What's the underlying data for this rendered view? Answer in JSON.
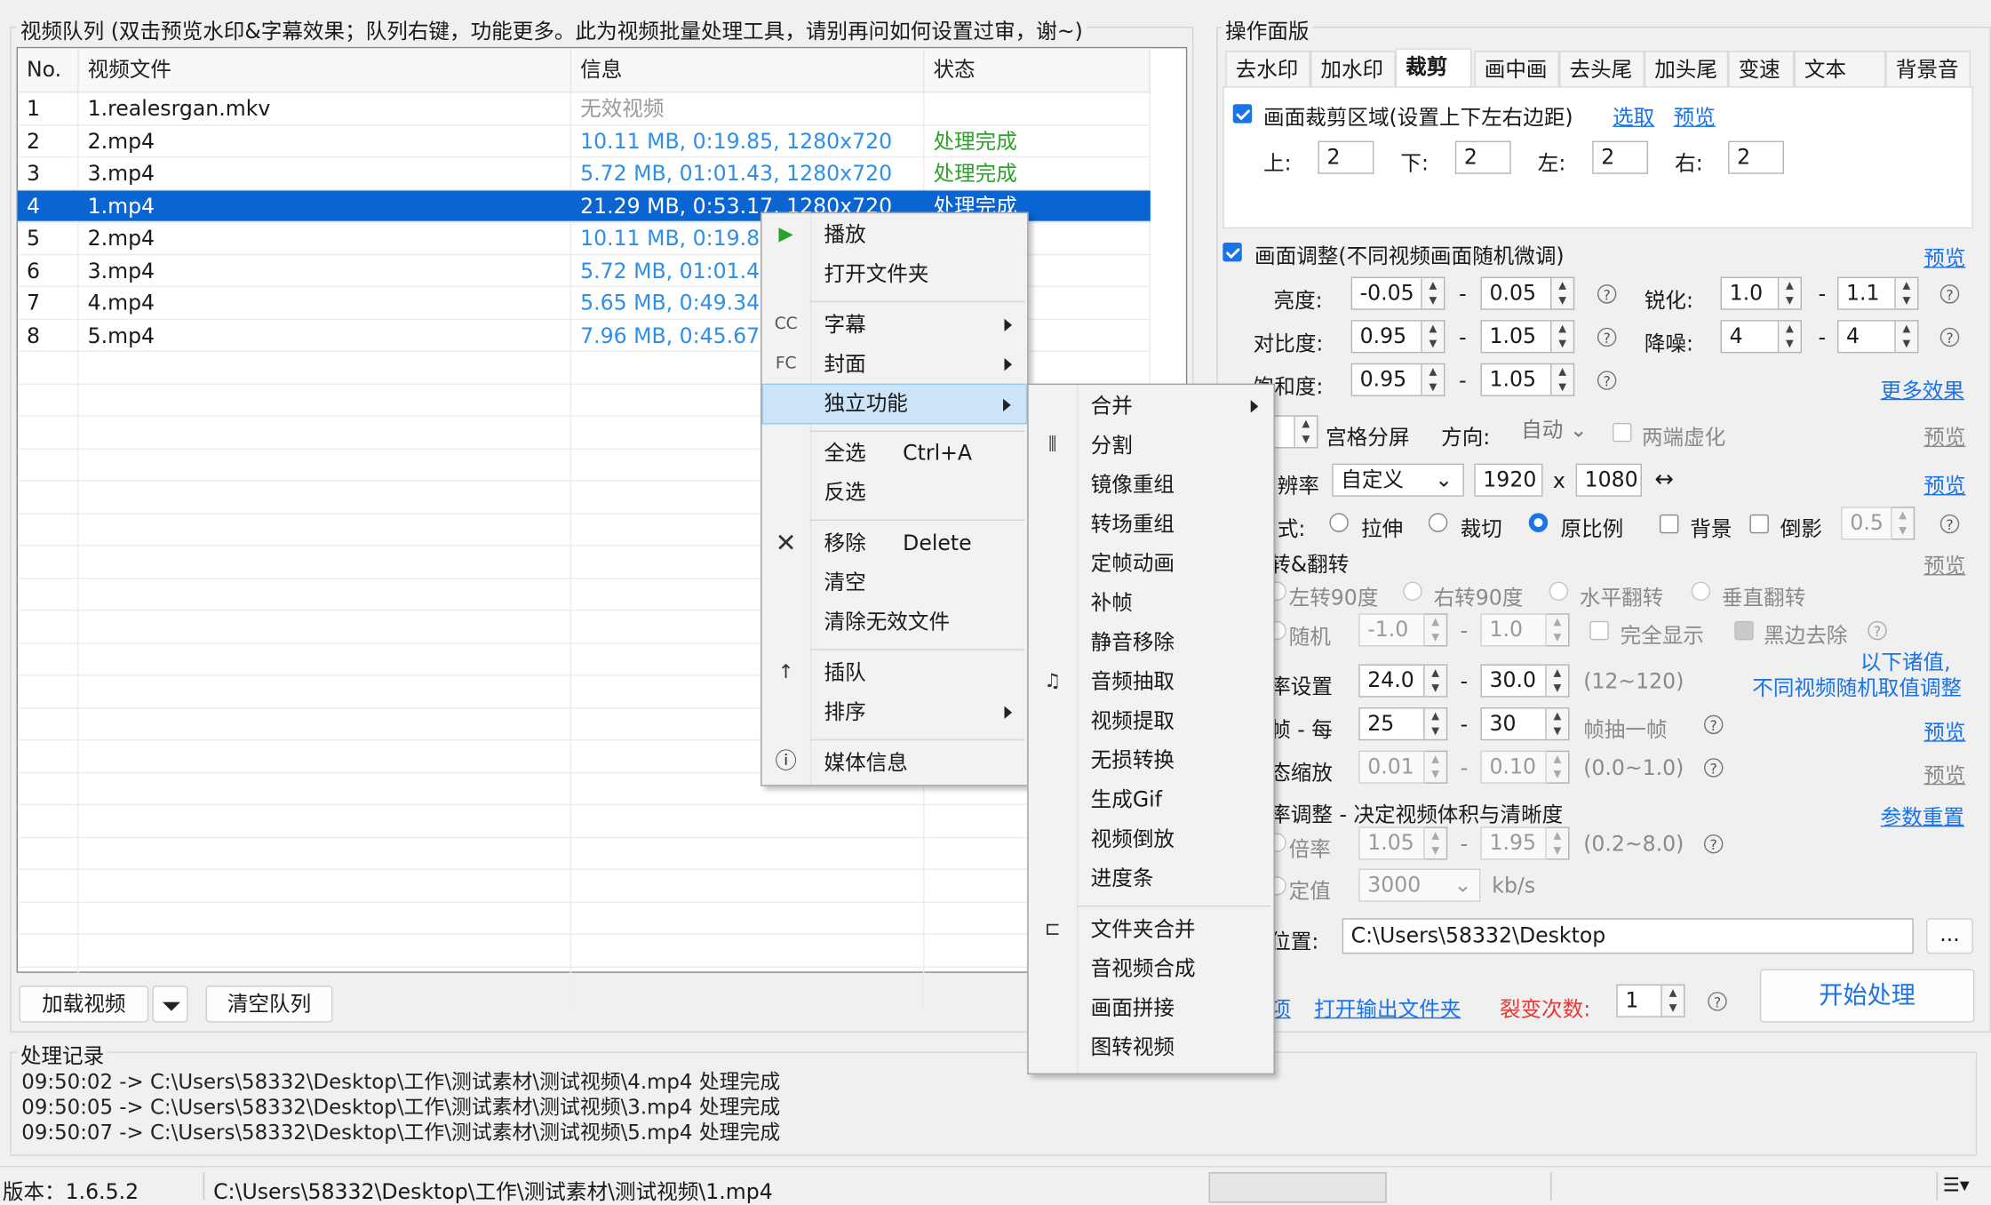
{
  "queue": {
    "title": "视频队列 (双击预览水印&字幕效果；队列右键，功能更多。此为视频批量处理工具，请别再问如何设置过审，谢~)",
    "columns": [
      "No.",
      "视频文件",
      "信息",
      "状态"
    ],
    "rows": [
      {
        "no": "1",
        "file": "1.realesrgan.mkv",
        "info": "无效视频",
        "status": ""
      },
      {
        "no": "2",
        "file": "2.mp4",
        "info": "10.11 MB, 0:19.85, 1280x720",
        "status": "处理完成"
      },
      {
        "no": "3",
        "file": "3.mp4",
        "info": "5.72 MB, 01:01.43, 1280x720",
        "status": "处理完成"
      },
      {
        "no": "4",
        "file": "1.mp4",
        "info": "21.29 MB, 0:53.17, 1280x720",
        "status": "处理完成"
      },
      {
        "no": "5",
        "file": "2.mp4",
        "info": "10.11 MB, 0:19.85",
        "status": ""
      },
      {
        "no": "6",
        "file": "3.mp4",
        "info": "5.72 MB, 01:01.43",
        "status": ""
      },
      {
        "no": "7",
        "file": "4.mp4",
        "info": "5.65 MB, 0:49.34,",
        "status": ""
      },
      {
        "no": "8",
        "file": "5.mp4",
        "info": "7.96 MB, 0:45.67,",
        "status": ""
      }
    ],
    "selected_row": 4,
    "load_button": "加载视频",
    "clear_button": "清空队列"
  },
  "log": {
    "title": "处理记录",
    "lines": [
      "09:50:02 -> C:\\Users\\58332\\Desktop\\工作\\测试素材\\测试视频\\4.mp4 处理完成",
      "09:50:05 -> C:\\Users\\58332\\Desktop\\工作\\测试素材\\测试视频\\3.mp4 处理完成",
      "09:50:07 -> C:\\Users\\58332\\Desktop\\工作\\测试素材\\测试视频\\5.mp4 处理完成"
    ]
  },
  "statusbar": {
    "version": "版本：1.6.5.2",
    "path": "C:\\Users\\58332\\Desktop\\工作\\测试素材\\测试视频\\1.mp4"
  },
  "panel": {
    "title": "操作面版",
    "tabs": [
      "去水印",
      "加水印",
      "裁剪",
      "画中画",
      "去头尾",
      "加头尾",
      "变速",
      "文本",
      "背景音"
    ],
    "active_tab": "裁剪",
    "crop": {
      "label": "画面裁剪区域(设置上下左右边距)",
      "select_link": "选取",
      "preview_link": "预览",
      "top_label": "上:",
      "top": "2",
      "bottom_label": "下:",
      "bottom": "2",
      "left_label": "左:",
      "left": "2",
      "right_label": "右:",
      "right": "2"
    },
    "adjust": {
      "label": "画面调整(不同视频画面随机微调)",
      "preview_link": "预览",
      "brightness_label": "亮度:",
      "brightness_min": "-0.05",
      "brightness_max": "0.05",
      "contrast_label": "对比度:",
      "contrast_min": "0.95",
      "contrast_max": "1.05",
      "saturation_label": "饱和度:",
      "saturation_min": "0.95",
      "saturation_max": "1.05",
      "sharpen_label": "锐化:",
      "sharpen_min": "1.0",
      "sharpen_max": "1.1",
      "denoise_label": "降噪:",
      "denoise_min": "4",
      "denoise_max": "4",
      "more_link": "更多效果",
      "dash": "-"
    },
    "grid": {
      "label": "宫格分屏",
      "dir_label": "方向:",
      "dir_value": "自动",
      "blur_label": "两端虚化",
      "preview_link": "预览"
    },
    "resolution": {
      "label": "辨率",
      "mode": "自定义",
      "width": "1920",
      "x": "x",
      "height": "1080",
      "swap": "↔",
      "preview_link": "预览"
    },
    "mode": {
      "label": "式:",
      "stretch": "拉伸",
      "crop": "裁切",
      "original": "原比例",
      "bg": "背景",
      "reflect": "倒影",
      "reflect_value": "0.5"
    },
    "rotate": {
      "label": "转&翻转",
      "preview_link": "预览",
      "left90": "左转90度",
      "right90": "右转90度",
      "hflip": "水平翻转",
      "vflip": "垂直翻转",
      "random": "随机",
      "rand_min": "-1.0",
      "rand_max": "1.0",
      "full": "完全显示",
      "black": "黑边去除"
    },
    "note": {
      "line1": "以下诸值,",
      "line2": "不同视频随机取值调整"
    },
    "fps": {
      "label": "率设置",
      "min": "24.0",
      "max": "30.0",
      "range": "(12~120)"
    },
    "frame": {
      "label": "帧 - 每",
      "min": "25",
      "max": "30",
      "suffix": "帧抽一帧",
      "preview_link": "预览"
    },
    "zoom": {
      "label": "态缩放",
      "min": "0.01",
      "max": "0.10",
      "range": "(0.0~1.0)",
      "preview_link": "预览"
    },
    "bitrate": {
      "label": "率调整 - 决定视频体积与清晰度",
      "reset_link": "参数重置",
      "ratio_label": "倍率",
      "ratio_min": "1.05",
      "ratio_max": "1.95",
      "ratio_range": "(0.2~8.0)",
      "fixed_label": "定值",
      "fixed_value": "3000",
      "unit": "kb/s"
    },
    "output": {
      "label": "位置:",
      "path": "C:\\Users\\58332\\Desktop",
      "browse": "..."
    },
    "bottom": {
      "link1": "项",
      "open_folder": "打开输出文件夹",
      "split_label": "裂变次数:",
      "split_value": "1",
      "start": "开始处理"
    }
  },
  "context_menu": {
    "items": {
      "play": "播放",
      "open_folder": "打开文件夹",
      "subtitle": "字幕",
      "cover": "封面",
      "standalone": "独立功能",
      "select_all": "全选",
      "select_all_key": "Ctrl+A",
      "invert": "反选",
      "remove": "移除",
      "remove_key": "Delete",
      "clear": "清空",
      "clear_invalid": "清除无效文件",
      "insert": "插队",
      "sort": "排序",
      "media_info": "媒体信息"
    },
    "icons": {
      "cc": "CC",
      "fc": "FC"
    }
  },
  "submenu": {
    "items": [
      "合并",
      "分割",
      "镜像重组",
      "转场重组",
      "定帧动画",
      "补帧",
      "静音移除",
      "音频抽取",
      "视频提取",
      "无损转换",
      "生成Gif",
      "视频倒放",
      "进度条",
      "文件夹合并",
      "音视频合成",
      "画面拼接",
      "图转视频"
    ]
  },
  "colors": {
    "accent": "#1a73e8",
    "selection": "#0a64d2",
    "done": "#2aa32a",
    "info": "#2f8fe8",
    "warn": "#e53935"
  }
}
